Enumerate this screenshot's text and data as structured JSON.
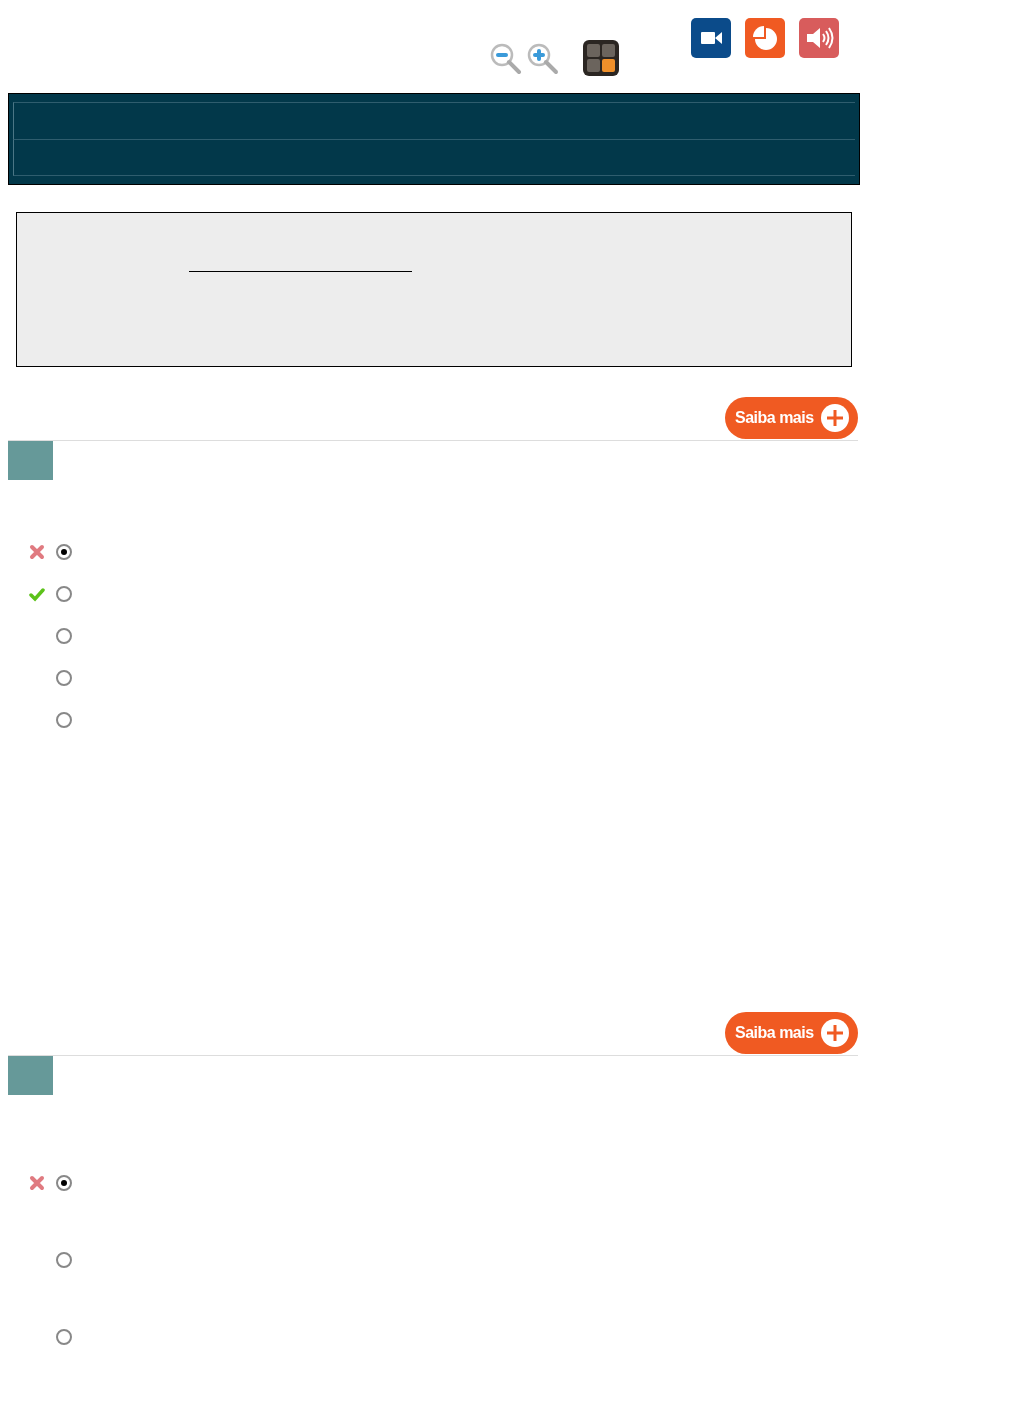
{
  "questions": [
    {
      "more_button": "Saiba mais",
      "kind": "compact",
      "options": [
        {
          "selected": true,
          "graded": true,
          "correct": false
        },
        {
          "selected": false,
          "graded": true,
          "correct": true
        },
        {
          "selected": false,
          "graded": false
        },
        {
          "selected": false,
          "graded": false
        },
        {
          "selected": false,
          "graded": false
        }
      ]
    },
    {
      "more_button": "Saiba mais",
      "kind": "wide",
      "options": [
        {
          "selected": true,
          "graded": true,
          "correct": false
        },
        {
          "selected": false,
          "graded": false
        },
        {
          "selected": false,
          "graded": false
        }
      ]
    }
  ]
}
